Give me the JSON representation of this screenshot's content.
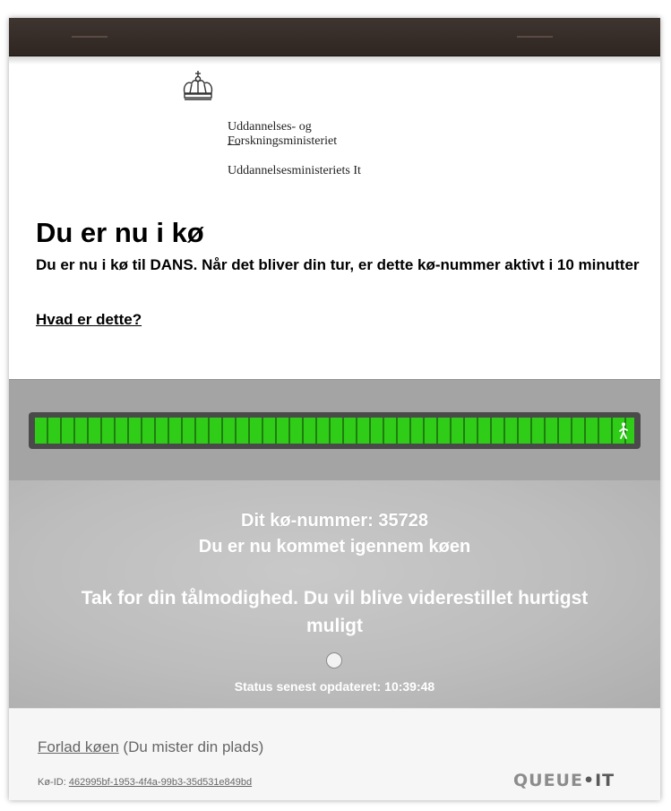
{
  "logo": {
    "line1": "Uddannelses- og",
    "line2": "Forskningsministeriet",
    "line3": "Uddannelsesministeriets It",
    "icon": "crown-icon"
  },
  "page": {
    "title": "Du er nu i kø",
    "description": "Du er nu i kø til DANS. Når det bliver din tur, er dette kø-nummer aktivt i 10 minutter",
    "help_link": "Hvad er dette?"
  },
  "progress": {
    "percent": 100,
    "bar_color": "#2fcd17",
    "icon": "walking-person-icon"
  },
  "status": {
    "queue_number": "Dit kø-nummer: 35728",
    "through_text": "Du er nu kommet igennem køen",
    "thanks_text": "Tak for din tålmodighed. Du vil blive viderestillet hurtigst muligt",
    "updated_label": "Status senest opdateret:",
    "updated_time": "10:39:48"
  },
  "footer": {
    "leave_link": "Forlad køen",
    "leave_note": " (Du mister din plads)",
    "queue_id_label": "Kø-ID:",
    "queue_id": "462995bf-1953-4f4a-99b3-35d531e849bd",
    "brand_part1": "QUEUE",
    "brand_part2": "•IT"
  }
}
